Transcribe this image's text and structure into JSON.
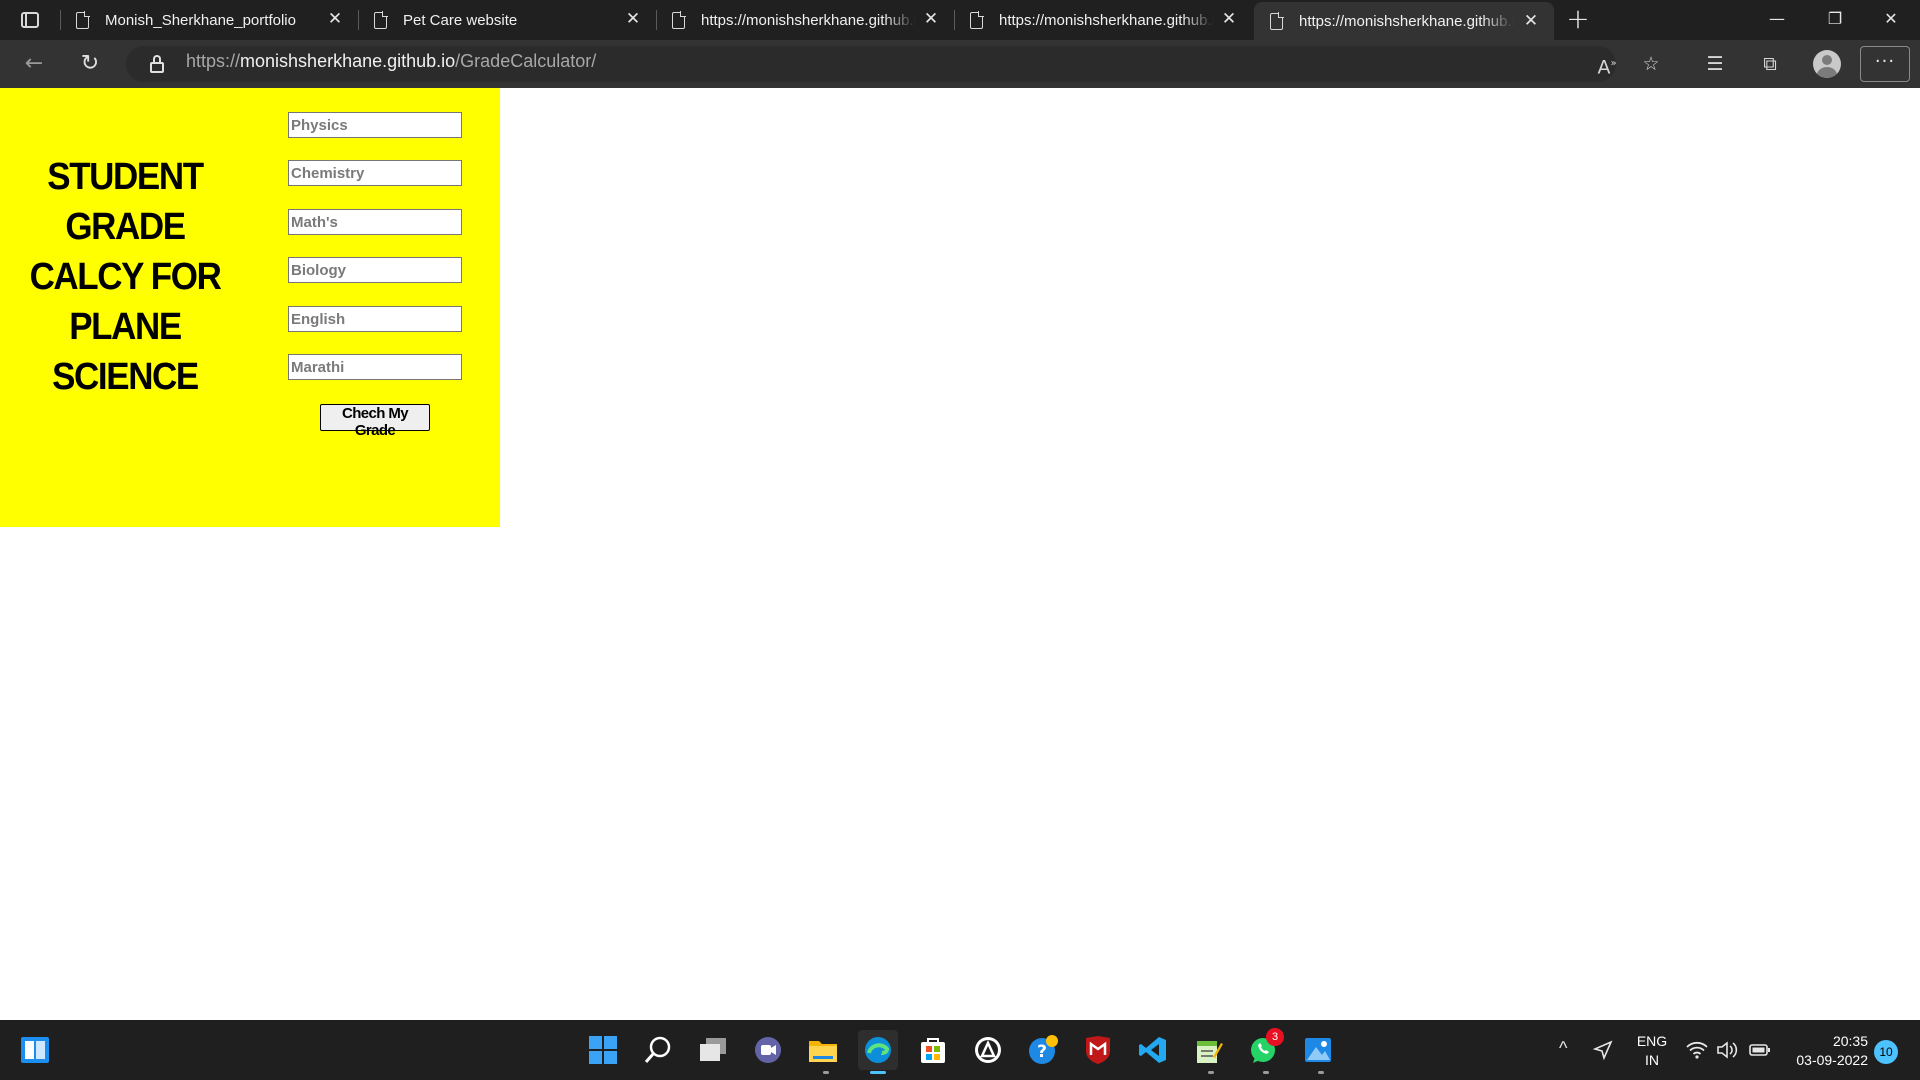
{
  "browser": {
    "tabs": [
      {
        "title": "Monish_Sherkhane_portfolio",
        "active": false
      },
      {
        "title": "Pet Care website",
        "active": false
      },
      {
        "title": "https://monishsherkhane.github.io/",
        "active": false
      },
      {
        "title": "https://monishsherkhane.github.io/",
        "active": false
      },
      {
        "title": "https://monishsherkhane.github.io/",
        "active": true
      }
    ],
    "url": {
      "scheme": "https://",
      "host": "monishsherkhane.github.io",
      "path": "/GradeCalculator/"
    },
    "window_controls": [
      "minimize",
      "restore",
      "close"
    ]
  },
  "page": {
    "background": "#ffffff",
    "panel_color": "#ffff00",
    "heading": "STUDENT GRADE CALCY FOR PLANE SCIENCE",
    "fields": [
      {
        "placeholder": "Physics"
      },
      {
        "placeholder": "Chemistry"
      },
      {
        "placeholder": "Math's"
      },
      {
        "placeholder": "Biology"
      },
      {
        "placeholder": "English"
      },
      {
        "placeholder": "Marathi"
      }
    ],
    "submit_label": "Chech My Grade"
  },
  "taskbar": {
    "apps": [
      "start-icon",
      "search-icon",
      "task-view-icon",
      "teams-chat-icon",
      "file-explorer-icon",
      "edge-icon",
      "store-icon",
      "vpn-icon",
      "help-icon",
      "mcafee-icon",
      "vscode-icon",
      "notepad-icon",
      "whatsapp-icon",
      "photos-icon"
    ],
    "whatsapp_badge": "3",
    "language": "ENG",
    "region": "IN",
    "time": "20:35",
    "date": "03-09-2022",
    "notification_count": "10"
  }
}
